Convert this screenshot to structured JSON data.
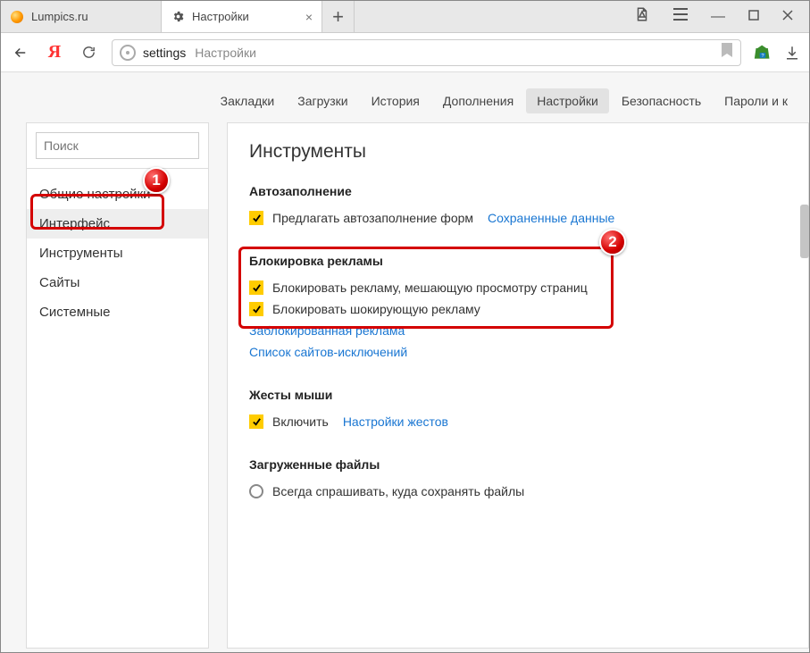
{
  "tabs": [
    {
      "title": "Lumpics.ru",
      "icon": "orange"
    },
    {
      "title": "Настройки",
      "icon": "gear",
      "active": true
    }
  ],
  "window_controls": {
    "reader": "reader",
    "menu": "menu",
    "minimize": "—",
    "maximize": "▢",
    "close": "✕"
  },
  "addressbar": {
    "url_main": "settings",
    "url_sub": "Настройки"
  },
  "settings_nav": [
    "Закладки",
    "Загрузки",
    "История",
    "Дополнения",
    "Настройки",
    "Безопасность",
    "Пароли и к"
  ],
  "settings_nav_active_index": 4,
  "sidebar": {
    "search_placeholder": "Поиск",
    "items": [
      "Общие настройки",
      "Интерфейс",
      "Инструменты",
      "Сайты",
      "Системные"
    ],
    "selected_index": 1
  },
  "main": {
    "heading": "Инструменты",
    "sections": {
      "autofill": {
        "title": "Автозаполнение",
        "option": "Предлагать автозаполнение форм",
        "link": "Сохраненные данные"
      },
      "adblock": {
        "title": "Блокировка рекламы",
        "opt1": "Блокировать рекламу, мешающую просмотру страниц",
        "opt2": "Блокировать шокирующую рекламу",
        "link1": "Заблокированная реклама",
        "link2": "Список сайтов-исключений"
      },
      "mouse": {
        "title": "Жесты мыши",
        "option": "Включить",
        "link": "Настройки жестов"
      },
      "downloads": {
        "title": "Загруженные файлы",
        "option": "Всегда спрашивать, куда сохранять файлы"
      }
    }
  },
  "annotations": {
    "badge1": "1",
    "badge2": "2"
  }
}
